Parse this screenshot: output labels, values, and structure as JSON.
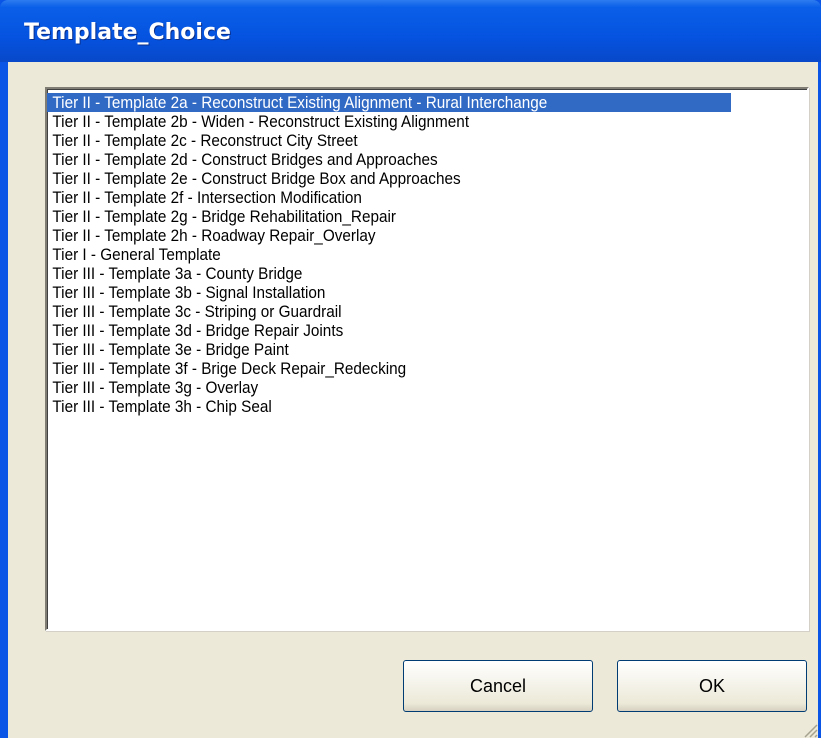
{
  "window": {
    "title": "Template_Choice"
  },
  "listbox": {
    "items": [
      {
        "label": "Tier II - Template 2a - Reconstruct Existing Alignment - Rural Interchange",
        "selected": true
      },
      {
        "label": "Tier II - Template 2b - Widen - Reconstruct Existing Alignment",
        "selected": false
      },
      {
        "label": "Tier II - Template 2c - Reconstruct City Street",
        "selected": false
      },
      {
        "label": "Tier II - Template 2d - Construct Bridges and Approaches",
        "selected": false
      },
      {
        "label": "Tier II - Template 2e - Construct Bridge Box and Approaches",
        "selected": false
      },
      {
        "label": "Tier II - Template 2f  - Intersection Modification",
        "selected": false
      },
      {
        "label": "Tier II - Template 2g - Bridge Rehabilitation_Repair",
        "selected": false
      },
      {
        "label": "Tier II - Template 2h - Roadway Repair_Overlay",
        "selected": false
      },
      {
        "label": "Tier I - General Template",
        "selected": false
      },
      {
        "label": "Tier III - Template 3a - County Bridge",
        "selected": false
      },
      {
        "label": "Tier III - Template 3b - Signal Installation",
        "selected": false
      },
      {
        "label": "Tier III - Template 3c - Striping or Guardrail",
        "selected": false
      },
      {
        "label": "Tier III - Template 3d - Bridge Repair Joints",
        "selected": false
      },
      {
        "label": "Tier III - Template 3e - Bridge Paint",
        "selected": false
      },
      {
        "label": "Tier III - Template 3f - Brige Deck Repair_Redecking",
        "selected": false
      },
      {
        "label": "Tier III - Template 3g - Overlay",
        "selected": false
      },
      {
        "label": "Tier III - Template 3h - Chip Seal",
        "selected": false
      }
    ]
  },
  "buttons": {
    "cancel_label": "Cancel",
    "ok_label": "OK"
  },
  "colors": {
    "titlebar": "#0553e0",
    "selection": "#316ac5",
    "dialog_background": "#ece9d8"
  }
}
